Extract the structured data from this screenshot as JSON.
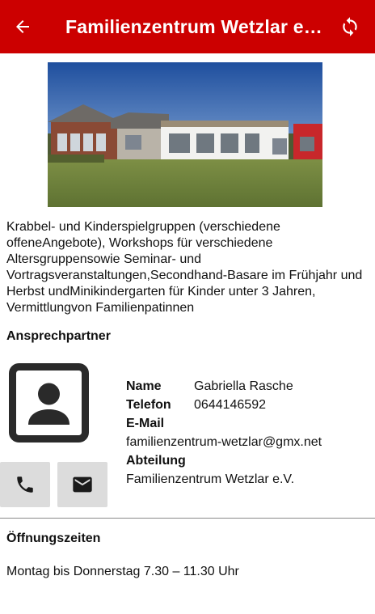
{
  "app_bar": {
    "title": "Familienzentrum Wetzlar e.V.",
    "back_icon": "arrow-left-icon",
    "refresh_icon": "refresh-icon",
    "background_color": "#cc0000"
  },
  "description": "Krabbel- und Kinderspielgruppen (verschiedene offeneAngebote), Workshops für verschiedene Altersgruppensowie Seminar- und Vortragsveranstaltungen,Secondhand-Basare im Frühjahr und Herbst undMinikindergarten für Kinder unter 3 Jahren, Vermittlungvon Familienpatinnen",
  "contact": {
    "heading": "Ansprechpartner",
    "picture_icon": "person-placeholder-icon",
    "name_label": "Name",
    "name_value": "Gabriella Rasche",
    "phone_label": "Telefon",
    "phone_value": "0644146592",
    "email_label": "E-Mail",
    "email_value": "familienzentrum-wetzlar@gmx.net",
    "department_label": "Abteilung",
    "department_value": "Familienzentrum Wetzlar e.V.",
    "call_icon": "phone-icon",
    "mail_icon": "mail-icon"
  },
  "opening_hours": {
    "heading": "Öffnungszeiten",
    "text": "Montag bis Donnerstag 7.30 – 11.30 Uhr"
  }
}
